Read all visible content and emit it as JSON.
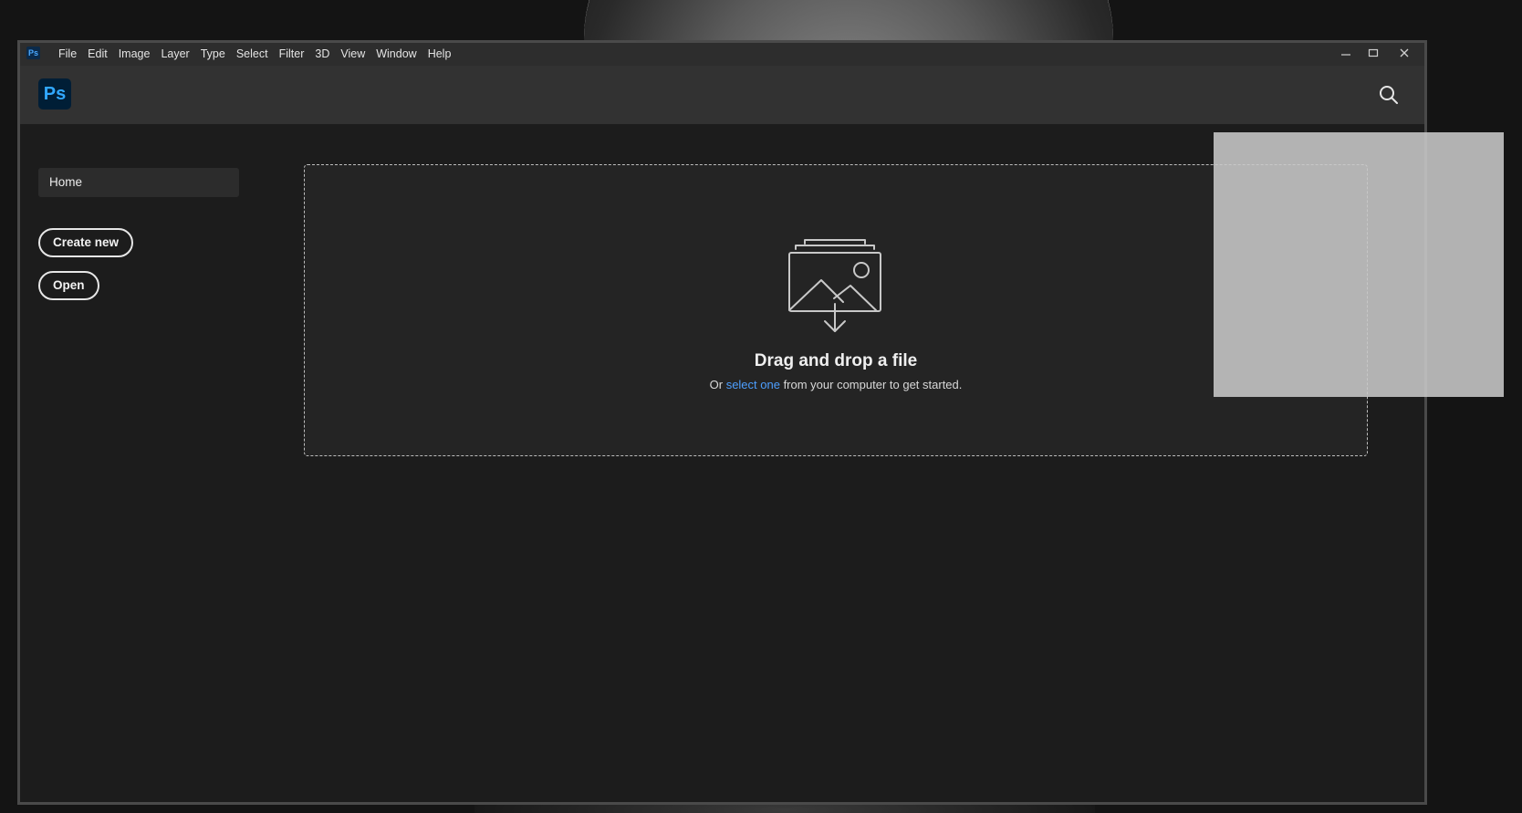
{
  "titlebar": {
    "app_icon_text": "Ps",
    "menu": [
      "File",
      "Edit",
      "Image",
      "Layer",
      "Type",
      "Select",
      "Filter",
      "3D",
      "View",
      "Window",
      "Help"
    ],
    "controls": {
      "minimize": "minimize-icon",
      "maximize": "maximize-icon",
      "close": "close-icon"
    }
  },
  "header": {
    "logo_text": "Ps",
    "search_icon": "search-icon"
  },
  "sidebar": {
    "home_label": "Home",
    "create_new_label": "Create new",
    "open_label": "Open"
  },
  "dropzone": {
    "icon": "image-upload-icon",
    "title": "Drag and drop a file",
    "subtitle_prefix": "Or ",
    "subtitle_link": "select one",
    "subtitle_suffix": " from your computer to get started."
  },
  "colors": {
    "accent_blue": "#31a8ff",
    "link_blue": "#4d9fff",
    "logo_bg": "#001e36",
    "window_bg": "#1c1c1c",
    "header_bg": "#323232"
  }
}
